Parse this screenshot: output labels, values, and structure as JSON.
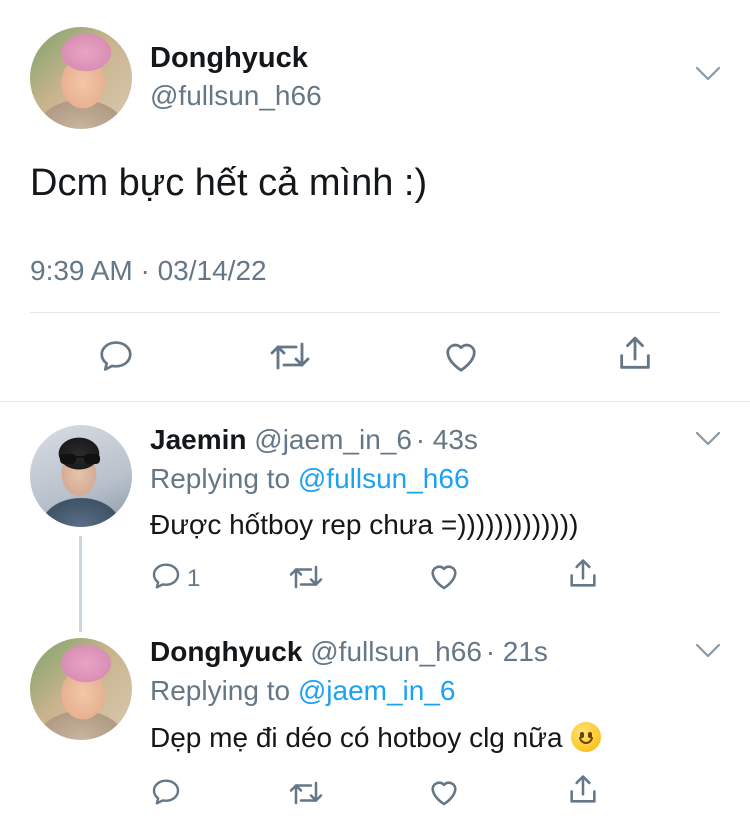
{
  "main_tweet": {
    "name": "Donghyuck",
    "handle": "@fullsun_h66",
    "text": "Dcm bực hết cả mình :)",
    "timestamp": "9:39 AM · 03/14/22"
  },
  "replies": [
    {
      "name": "Jaemin",
      "handle": "@jaem_in_6",
      "time": "· 43s",
      "replying_label": "Replying to",
      "replying_to": "@fullsun_h66",
      "text": "Được hốtboy rep chưa =)))))))))))))",
      "reply_count": "1"
    },
    {
      "name": "Donghyuck",
      "handle": "@fullsun_h66",
      "time": "· 21s",
      "replying_label": "Replying to",
      "replying_to": "@jaem_in_6",
      "text": "Dẹp mẹ đi déo có hotboy clg nữa",
      "emoji": "slightly-smiling-face"
    }
  ],
  "colors": {
    "text": "#14171a",
    "secondary": "#657786",
    "accent": "#1da1f2",
    "divider": "#e1e8ed"
  }
}
